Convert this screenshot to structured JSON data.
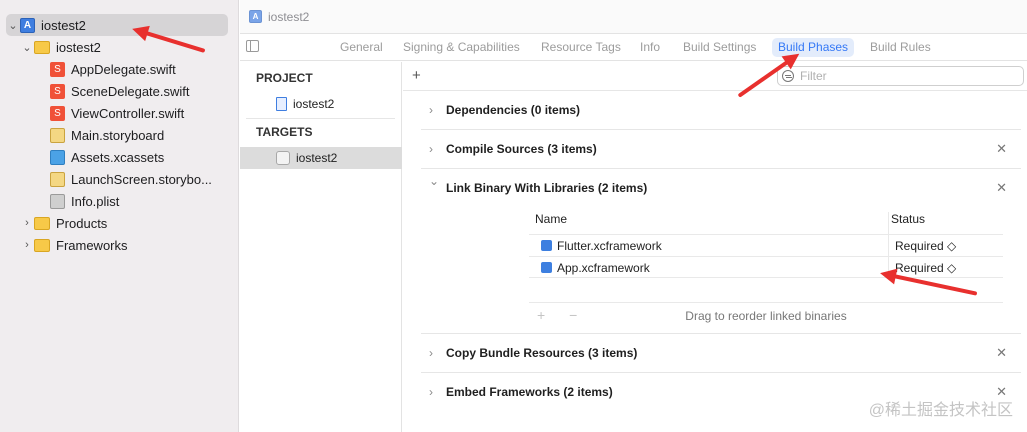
{
  "navigator": {
    "items": [
      {
        "label": "iostest2",
        "icon": "project-icon"
      },
      {
        "label": "iostest2",
        "icon": "folder-icon"
      },
      {
        "label": "AppDelegate.swift",
        "icon": "swift-file-icon"
      },
      {
        "label": "SceneDelegate.swift",
        "icon": "swift-file-icon"
      },
      {
        "label": "ViewController.swift",
        "icon": "swift-file-icon"
      },
      {
        "label": "Main.storyboard",
        "icon": "storyboard-icon"
      },
      {
        "label": "Assets.xcassets",
        "icon": "assets-icon"
      },
      {
        "label": "LaunchScreen.storybo...",
        "icon": "storyboard-icon"
      },
      {
        "label": "Info.plist",
        "icon": "plist-icon"
      },
      {
        "label": "Products",
        "icon": "folder-icon"
      },
      {
        "label": "Frameworks",
        "icon": "folder-icon"
      }
    ]
  },
  "breadcrumb": {
    "label": "iostest2"
  },
  "tabs": [
    {
      "label": "General"
    },
    {
      "label": "Signing & Capabilities"
    },
    {
      "label": "Resource Tags"
    },
    {
      "label": "Info"
    },
    {
      "label": "Build Settings"
    },
    {
      "label": "Build Phases"
    },
    {
      "label": "Build Rules"
    }
  ],
  "active_tab": "Build Phases",
  "project_list": {
    "project_header": "PROJECT",
    "project_item": "iostest2",
    "targets_header": "TARGETS",
    "target_item": "iostest2"
  },
  "toolbar": {
    "add_label": "+",
    "filter_placeholder": "Filter"
  },
  "phases": [
    {
      "title": "Dependencies (0 items)",
      "expanded": false,
      "removable": false
    },
    {
      "title": "Compile Sources (3 items)",
      "expanded": false,
      "removable": true
    },
    {
      "title": "Link Binary With Libraries (2 items)",
      "expanded": true,
      "removable": true
    },
    {
      "title": "Copy Bundle Resources (3 items)",
      "expanded": false,
      "removable": true
    },
    {
      "title": "Embed Frameworks (2 items)",
      "expanded": false,
      "removable": true
    }
  ],
  "libraries": {
    "columns": {
      "name": "Name",
      "status": "Status"
    },
    "rows": [
      {
        "name": "Flutter.xcframework",
        "status": "Required ◇"
      },
      {
        "name": "App.xcframework",
        "status": "Required ◇"
      }
    ],
    "footer_hint": "Drag to reorder linked binaries",
    "footer_buttons": "+ −"
  },
  "glyphs": {
    "chevron_right": "›",
    "chevron_down": "⌄",
    "close": "✕",
    "disclosure_open": "⌄",
    "disclosure_closed": "›"
  },
  "annotation_color": "#e8302e",
  "watermark": "@稀土掘金技术社区"
}
